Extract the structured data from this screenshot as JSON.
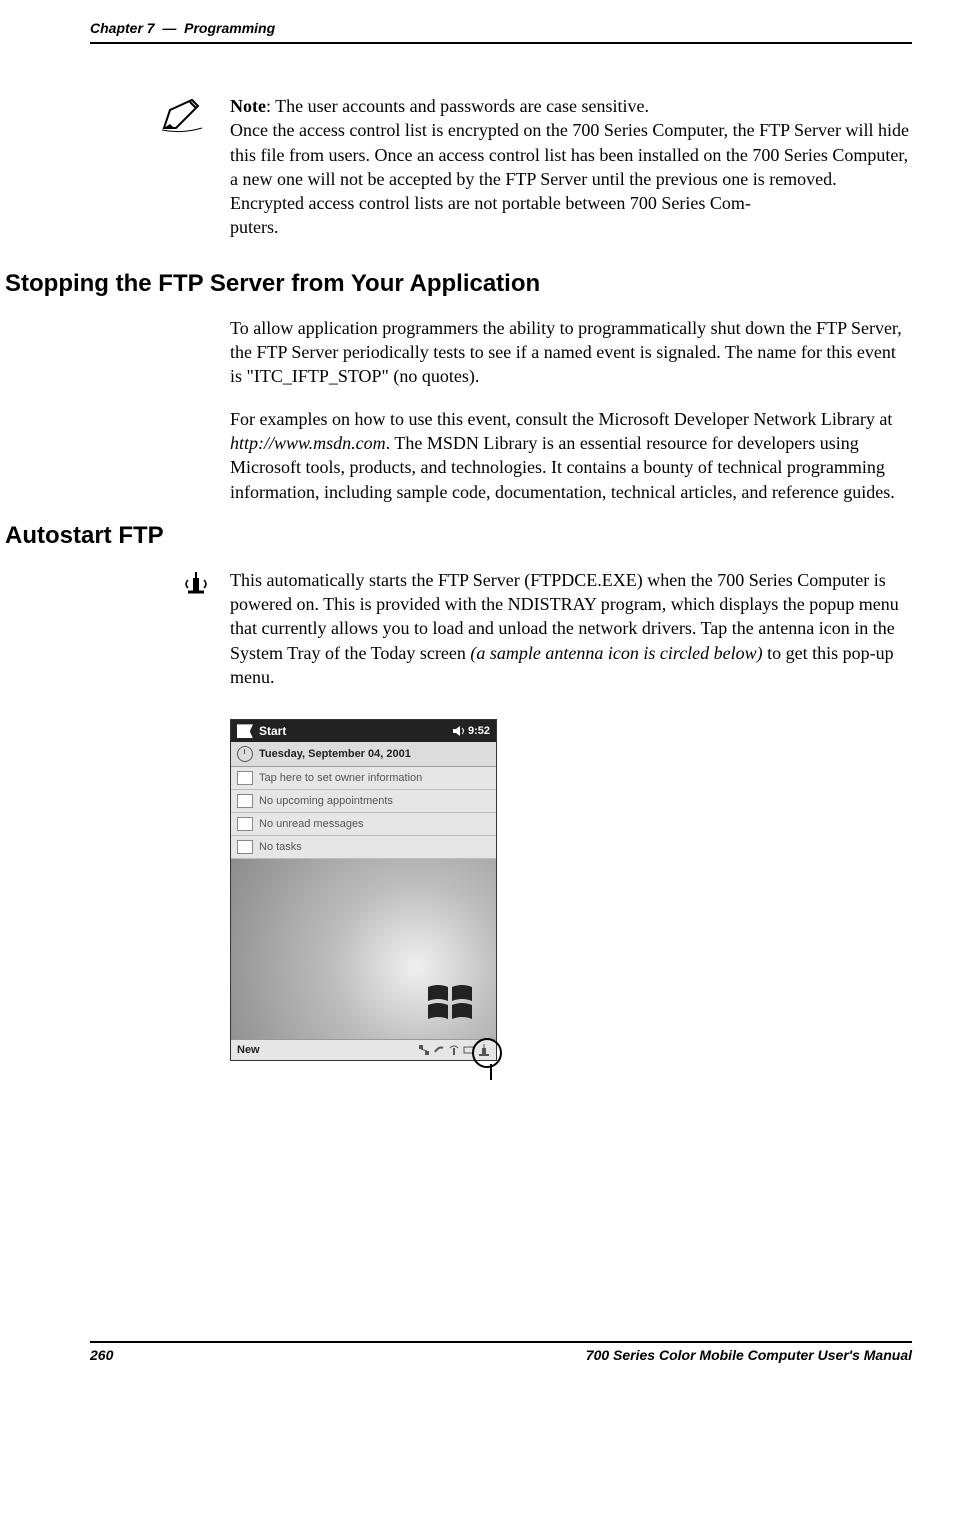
{
  "header": {
    "chapter": "Chapter 7",
    "dash": "—",
    "title": "Programming"
  },
  "note": {
    "label": "Note",
    "line1": ": The user accounts and passwords are case sensitive.",
    "line2": "Once the access control list is encrypted on the 700 Series Computer, the FTP Server will hide this file from users. Once an access control list has been installed on the 700 Series Computer, a new one will not be accepted by the FTP Server until the previous one is removed.",
    "line3": "Encrypted access control lists are not portable between 700 Series Com-",
    "line4": "puters."
  },
  "section1": {
    "heading": "Stopping the FTP Server from Your Application",
    "p1": "To allow application programmers the ability to programmatically shut down the FTP Server, the FTP Server periodically tests to see if a named event is signaled. The name for this event is \"ITC_IFTP_STOP\" (no quotes).",
    "p2a": "For examples on how to use this event, consult the Microsoft Developer Network Library at ",
    "p2url": "http://www.msdn.com",
    "p2b": ". The MSDN Library is an essential resource for developers using Microsoft tools, products, and technologies. It contains a bounty of technical programming information, including sample code, documentation, technical articles, and reference guides."
  },
  "section2": {
    "heading": "Autostart FTP",
    "p1a": "This automatically starts the FTP Server (FTPDCE.EXE) when the 700 Series Computer is powered on. This is provided with the NDISTRAY program, which displays the popup menu that currently allows you to load and unload the network drivers. Tap the antenna icon in the System Tray of the Today screen ",
    "p1ital": "(a sample antenna icon is circled below)",
    "p1b": " to get this pop-up menu."
  },
  "screenshot": {
    "start": "Start",
    "time": "9:52",
    "date": "Tuesday, September 04, 2001",
    "row_owner": "Tap here to set owner information",
    "row_appt": "No upcoming appointments",
    "row_msg": "No unread messages",
    "row_tasks": "No tasks",
    "new": "New"
  },
  "footer": {
    "page": "260",
    "manual": "700 Series Color Mobile Computer User's Manual"
  }
}
